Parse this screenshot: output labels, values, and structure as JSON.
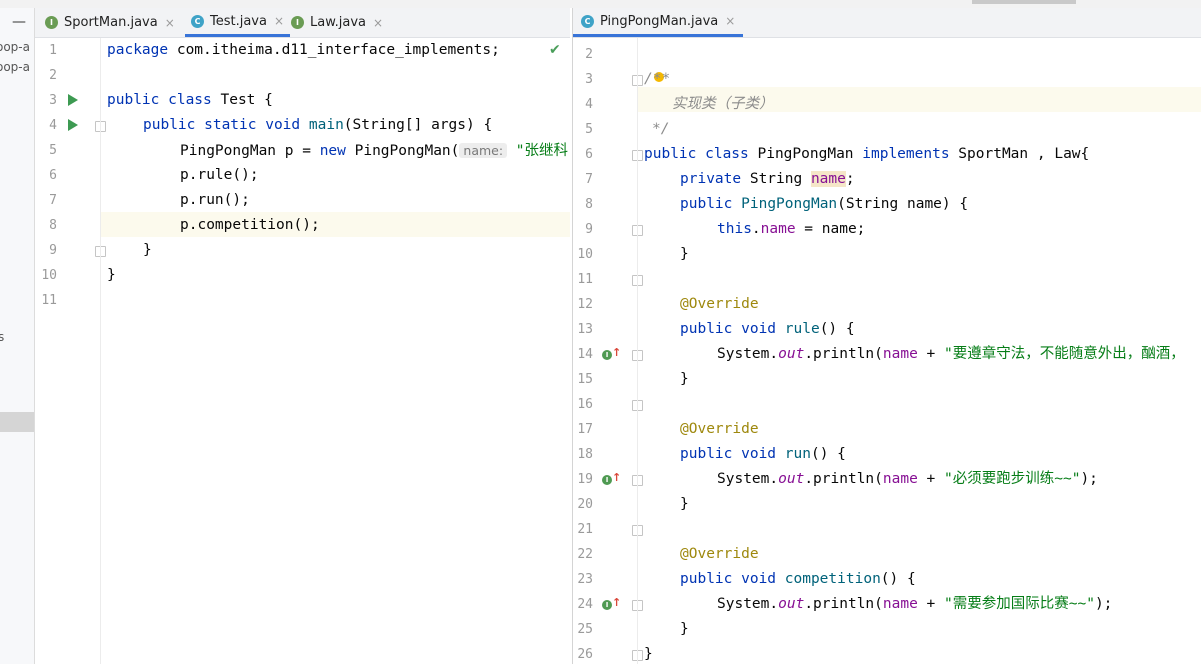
{
  "left_tabs": [
    {
      "label": "SportMan.java",
      "icon": "interface-icon",
      "active": false
    },
    {
      "label": "Test.java",
      "icon": "class-icon",
      "active": true
    },
    {
      "label": "Law.java",
      "icon": "interface-icon",
      "active": false
    }
  ],
  "right_tabs": [
    {
      "label": "PingPongMan.java",
      "icon": "class-icon",
      "active": true
    }
  ],
  "project_panel": {
    "items": [
      "oop-a",
      "oop-a",
      "s"
    ],
    "minimize": "—"
  },
  "tab_close": "×",
  "left_editor": {
    "line_numbers": [
      "1",
      "2",
      "3",
      "4",
      "5",
      "6",
      "7",
      "8",
      "9",
      "10",
      "11"
    ],
    "lines": {
      "l1_kw": "package",
      "l1_rest": " com.itheima.d11_interface_implements;",
      "l3_kw": "public class",
      "l3_rest": " Test {",
      "l4_kw": "public static void",
      "l4_fn": "main",
      "l4_rest": "(String[] args) {",
      "l5_a": "PingPongMan p = ",
      "l5_kw": "new",
      "l5_b": " PingPongMan(",
      "l5_hint": "name:",
      "l5_str": "\"张继科\");",
      "l6": "p.rule();",
      "l7": "p.run();",
      "l8": "p.competition();",
      "l9": "}",
      "l10": "}"
    },
    "check_mark": "✔"
  },
  "right_editor": {
    "line_numbers": [
      "2",
      "3",
      "4",
      "5",
      "6",
      "7",
      "8",
      "9",
      "10",
      "11",
      "12",
      "13",
      "14",
      "15",
      "16",
      "17",
      "18",
      "19",
      "20",
      "21",
      "22",
      "23",
      "24",
      "25",
      "26"
    ],
    "lines": {
      "l3": "/**",
      "l4": "实现类（子类）",
      "l5": "*/",
      "l6_kw1": "public class",
      "l6_a": " PingPongMan ",
      "l6_kw2": "implements",
      "l6_b": " SportMan , Law{",
      "l7_kw": "private",
      "l7_a": " String ",
      "l7_fld": "name",
      "l7_b": ";",
      "l8_kw": "public",
      "l8_fn": "PingPongMan",
      "l8_rest": "(String name) {",
      "l9_kw": "this",
      "l9_dot": ".",
      "l9_fld": "name",
      "l9_rest": " = name;",
      "close": "}",
      "override": "@Override",
      "l13_kw": "public void",
      "l13_fn": "rule",
      "paren_open": "() {",
      "sys": "System.",
      "out": "out",
      "println": ".println(",
      "name_fld": "name",
      "plus": " + ",
      "l14_str": "\"要遵章守法，不能随意外出，酗酒，",
      "l18_kw": "public void",
      "l18_fn": "run",
      "l19_str": "\"必须要跑步训练~~\"",
      "end_call": ");",
      "l23_kw": "public void",
      "l23_fn": "competition",
      "l24_str": "\"需要参加国际比赛~~\""
    },
    "impl_marker": "I",
    "up_arrow": "↑"
  },
  "colors": {
    "keyword": "#0033b3",
    "string": "#067d17",
    "field": "#871094",
    "annotation": "#9e880d",
    "active_tab_underline": "#3874d8",
    "current_line": "#fcfaed"
  }
}
